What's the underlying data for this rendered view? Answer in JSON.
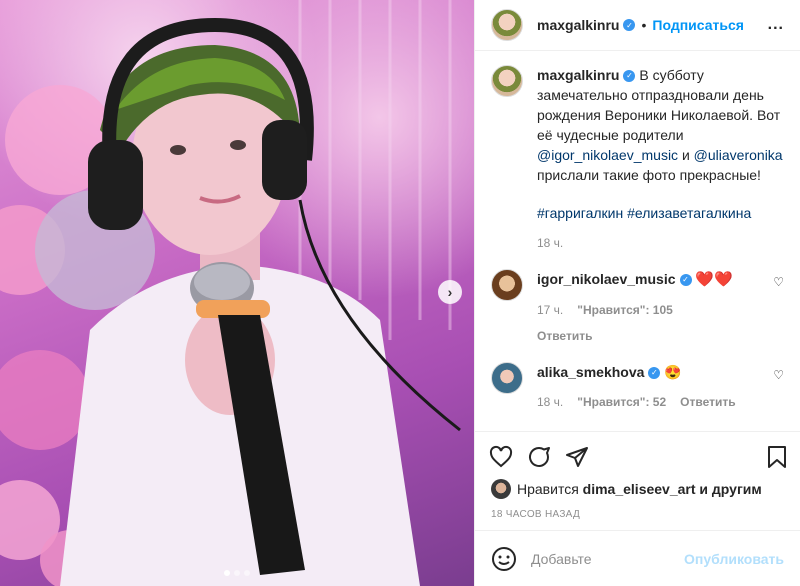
{
  "header": {
    "username": "maxgalkinru",
    "separator": "•",
    "follow_label": "Подписаться",
    "more_label": "..."
  },
  "caption": {
    "username": "maxgalkinru",
    "text_1": "В субботу замечательно отпраздновали день рождения Вероники Николаевой. Вот её чудесные родители ",
    "mention_1": "@igor_nikolaev_music",
    "and": " и ",
    "mention_2": "@uliaveronika",
    "text_2": " прислали такие фото прекрасные!",
    "hashtag_1": "#гарригалкин",
    "hashtag_2": "#елизаветагалкина",
    "time": "18 ч."
  },
  "comments": [
    {
      "username": "igor_nikolaev_music",
      "text": "❤️❤️",
      "time": "17 ч.",
      "likes_label": "\"Нравится\": 105",
      "reply": "Ответить"
    },
    {
      "username": "alika_smekhova",
      "text": "😍",
      "time": "18 ч.",
      "likes_label": "\"Нравится\": 52",
      "reply": "Ответить"
    }
  ],
  "likes": {
    "prefix": "Нравится",
    "user": "dima_eliseev_art",
    "suffix": "и другим"
  },
  "timestamp": "18 ЧАСОВ НАЗАД",
  "add_comment": {
    "placeholder": "Добавьте",
    "publish_label": "Опубликовать"
  },
  "carousel": {
    "count": 3,
    "active": 0
  },
  "icons": {
    "verified": "verified-badge-icon",
    "like": "heart-outline-icon",
    "comment": "comment-bubble-icon",
    "share": "paper-plane-icon",
    "save": "bookmark-icon",
    "emoji": "smiley-icon",
    "next": "chevron-right-icon"
  },
  "colors": {
    "accent": "#0095f6",
    "verified": "#3897f0",
    "publish_disabled": "#b2dffc",
    "muted": "#8e8e8e"
  }
}
